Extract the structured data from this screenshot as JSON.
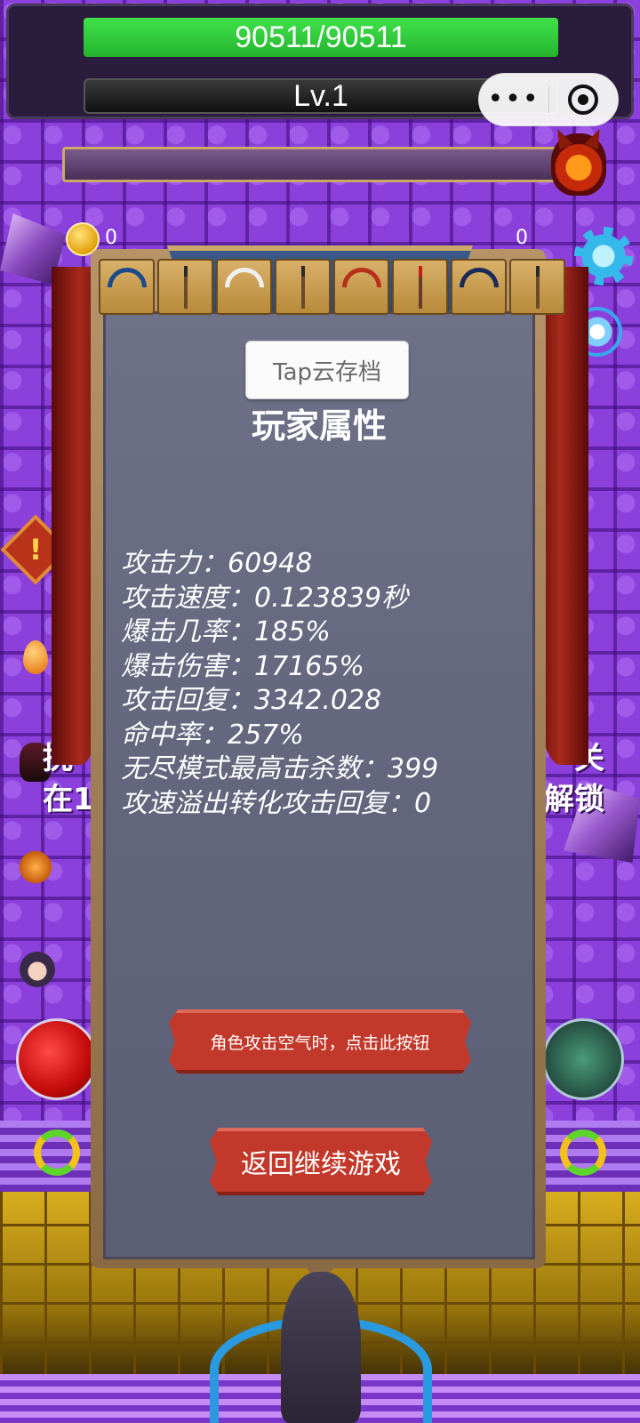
{
  "hud": {
    "hp_text": "90511/90511",
    "hp_fraction": 1.0,
    "level_text": "Lv.1",
    "capsule_more": "•••"
  },
  "currency": {
    "coin_count": "0",
    "second_count": "0"
  },
  "weapons": [
    {
      "name": "blue-crossbow-icon"
    },
    {
      "name": "arrow-icon"
    },
    {
      "name": "white-bow-icon"
    },
    {
      "name": "arrow-icon"
    },
    {
      "name": "red-bow-icon"
    },
    {
      "name": "red-arrow-icon"
    },
    {
      "name": "dark-bow-icon"
    },
    {
      "name": "arrow-icon"
    }
  ],
  "panel": {
    "tap_button": "Tap云存档",
    "title": "玩家属性",
    "stats": [
      "攻击力：60948",
      "攻击速度：0.123839秒",
      "爆击几率：185%",
      "爆击伤害：17165%",
      "攻击回复：3342.028",
      "命中率：257%",
      "无尽模式最高击杀数：399",
      "攻速溢出转化攻击回复：0"
    ],
    "air_button": "角色攻击空气时，点击此按钮",
    "return_button": "返回继续游戏"
  },
  "side_text": {
    "left_line1": "挑",
    "left_line2": "在1",
    "right_line1": "关",
    "right_line2": "解锁"
  },
  "colors": {
    "hp_green": "#3fe24a",
    "button_red": "#c2392b",
    "panel_gray": "#6e7187",
    "background_purple": "#8b40dc"
  }
}
